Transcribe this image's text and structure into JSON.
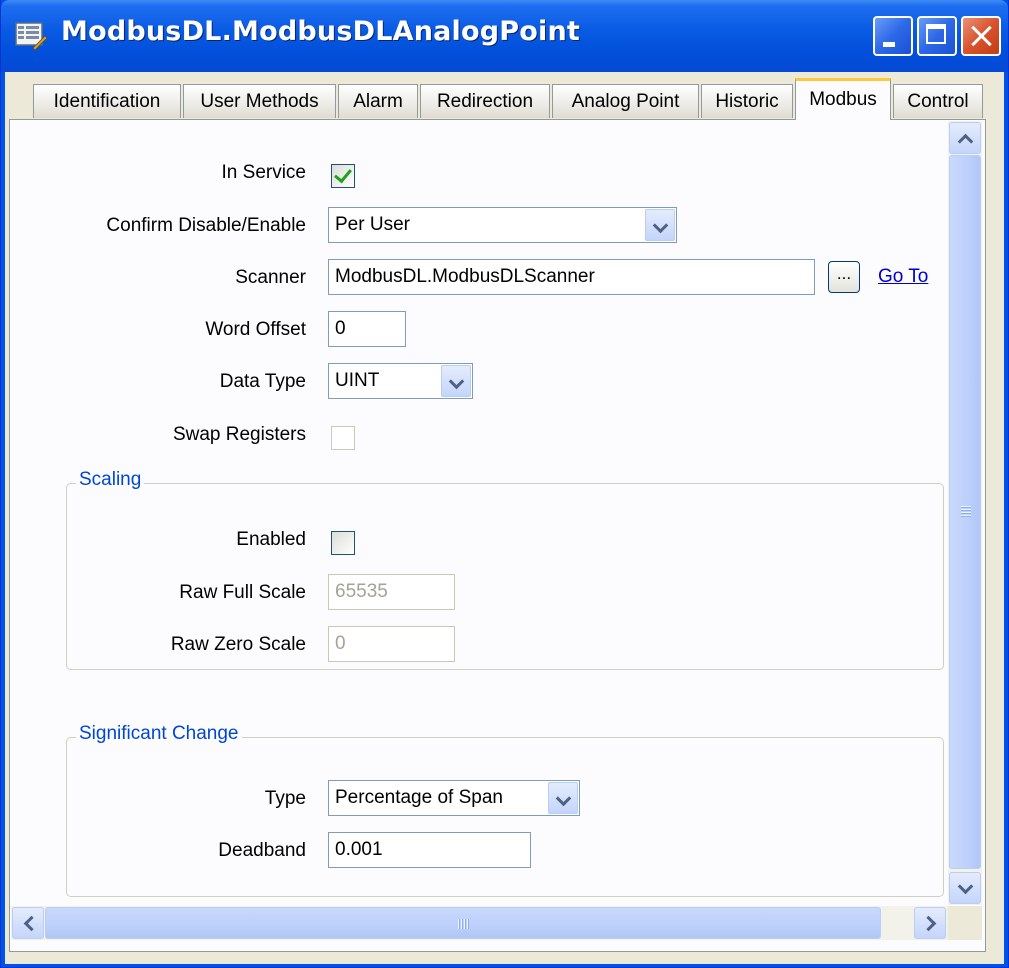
{
  "window": {
    "title": "ModbusDL.ModbusDLAnalogPoint"
  },
  "tabs": [
    {
      "label": "Identification",
      "active": false
    },
    {
      "label": "User Methods",
      "active": false
    },
    {
      "label": "Alarm",
      "active": false
    },
    {
      "label": "Redirection",
      "active": false
    },
    {
      "label": "Analog Point",
      "active": false
    },
    {
      "label": "Historic",
      "active": false
    },
    {
      "label": "Modbus",
      "active": true
    },
    {
      "label": "Control",
      "active": false
    }
  ],
  "modbus": {
    "in_service": {
      "label": "In Service",
      "checked": true
    },
    "confirm": {
      "label": "Confirm Disable/Enable",
      "value": "Per User"
    },
    "scanner": {
      "label": "Scanner",
      "value": "ModbusDL.ModbusDLScanner",
      "browse_label": "...",
      "goto_label": "Go To"
    },
    "word_offset": {
      "label": "Word Offset",
      "value": "0"
    },
    "data_type": {
      "label": "Data Type",
      "value": "UINT"
    },
    "swap_registers": {
      "label": "Swap Registers",
      "checked": false,
      "enabled": false
    }
  },
  "scaling": {
    "title": "Scaling",
    "enabled": {
      "label": "Enabled",
      "checked": false
    },
    "raw_full_scale": {
      "label": "Raw Full Scale",
      "value": "65535"
    },
    "raw_zero_scale": {
      "label": "Raw Zero Scale",
      "value": "0"
    }
  },
  "significant_change": {
    "title": "Significant Change",
    "type": {
      "label": "Type",
      "value": "Percentage of Span"
    },
    "deadband": {
      "label": "Deadband",
      "value": "0.001"
    }
  },
  "icons": {
    "app": "form-icon",
    "minimize": "minimize-icon",
    "maximize": "maximize-icon",
    "close": "close-icon"
  },
  "colors": {
    "titlebar": "#0a5ce4",
    "active_tab_accent": "#ffc83c",
    "group_title": "#0046d5",
    "link": "#0000cc",
    "check": "#21a121"
  }
}
